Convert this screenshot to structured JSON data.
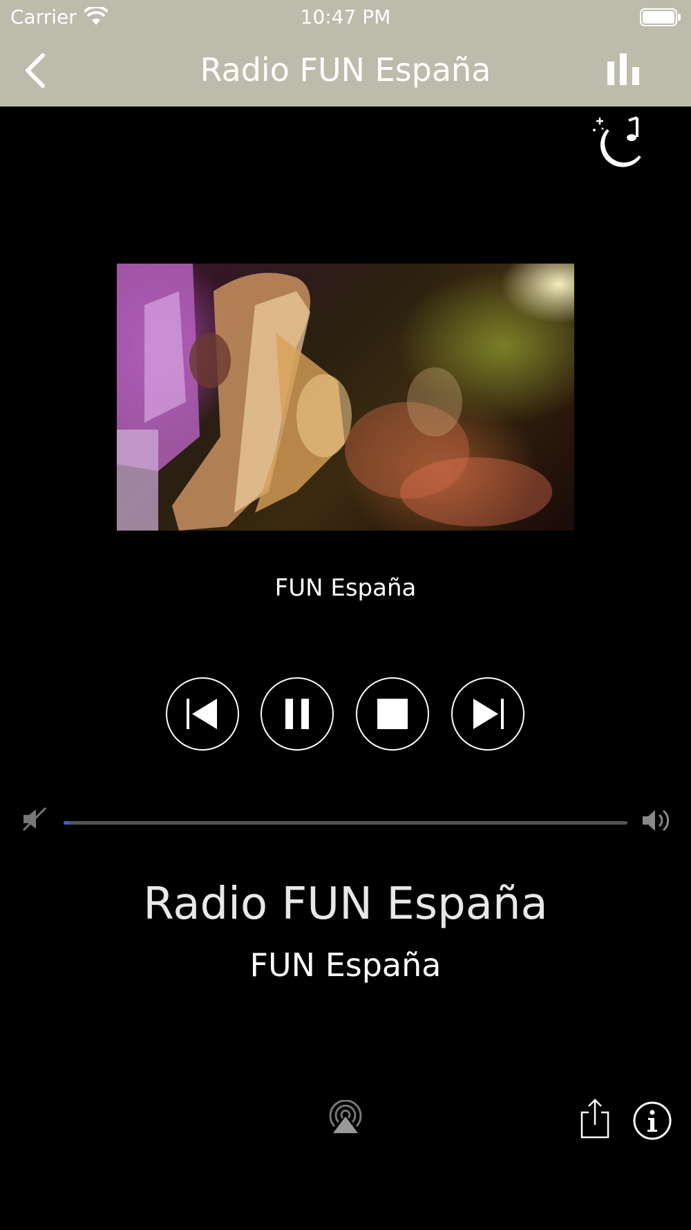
{
  "status_bar": {
    "carrier": "Carrier",
    "time": "10:47 PM"
  },
  "nav": {
    "title": "Radio FUN España"
  },
  "artwork": {
    "description_icon": "saxophone-photo"
  },
  "player": {
    "stream_label": "FUN España",
    "controls": [
      "previous",
      "pause",
      "stop",
      "next"
    ],
    "volume_fraction": 0.01
  },
  "now_playing": {
    "station_name": "Radio FUN España",
    "station_subtitle": "FUN España"
  },
  "colors": {
    "header_bg": "#bdbbab",
    "background": "#000000",
    "volume_accent": "#1f6fe5"
  },
  "icons": {
    "back": "chevron-left-icon",
    "equalizer": "equalizer-icon",
    "sleep_timer": "moon-music-icon",
    "mute": "speaker-muted-icon",
    "volume_up": "speaker-loud-icon",
    "airplay": "airplay-icon",
    "share": "share-icon",
    "info": "info-icon"
  }
}
